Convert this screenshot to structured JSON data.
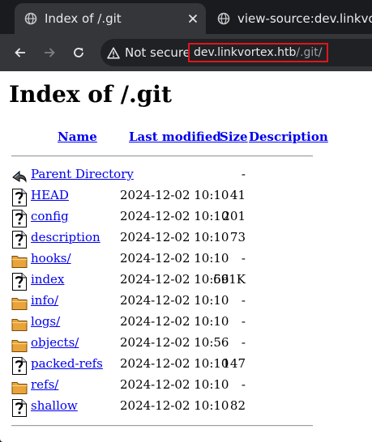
{
  "browser": {
    "tabs": [
      {
        "title": "Index of /.git",
        "active": true
      },
      {
        "title": "view-source:dev.linkvortex.htb/.git/",
        "active": false
      }
    ],
    "security_label": "Not secure",
    "url_host": "dev.linkvortex.htb",
    "url_path": "/.git/",
    "url_highlight_color": "#e0161c"
  },
  "page": {
    "heading": "Index of /.git",
    "columns": {
      "name": "Name",
      "modified": "Last modified",
      "size": "Size",
      "description": "Description"
    },
    "entries": [
      {
        "icon": "back-icon",
        "name": "Parent Directory",
        "modified": "",
        "size": "-"
      },
      {
        "icon": "unknown-file-icon",
        "name": "HEAD",
        "modified": "2024-12-02 10:10",
        "size": "41"
      },
      {
        "icon": "unknown-file-icon",
        "name": "config",
        "modified": "2024-12-02 10:10",
        "size": "201"
      },
      {
        "icon": "unknown-file-icon",
        "name": "description",
        "modified": "2024-12-02 10:10",
        "size": "73"
      },
      {
        "icon": "folder-icon",
        "name": "hooks/",
        "modified": "2024-12-02 10:10",
        "size": "-"
      },
      {
        "icon": "unknown-file-icon",
        "name": "index",
        "modified": "2024-12-02 10:56",
        "size": "691K"
      },
      {
        "icon": "folder-icon",
        "name": "info/",
        "modified": "2024-12-02 10:10",
        "size": "-"
      },
      {
        "icon": "folder-icon",
        "name": "logs/",
        "modified": "2024-12-02 10:10",
        "size": "-"
      },
      {
        "icon": "folder-icon",
        "name": "objects/",
        "modified": "2024-12-02 10:56",
        "size": "-"
      },
      {
        "icon": "unknown-file-icon",
        "name": "packed-refs",
        "modified": "2024-12-02 10:10",
        "size": "147"
      },
      {
        "icon": "folder-icon",
        "name": "refs/",
        "modified": "2024-12-02 10:10",
        "size": "-"
      },
      {
        "icon": "unknown-file-icon",
        "name": "shallow",
        "modified": "2024-12-02 10:10",
        "size": "82"
      }
    ]
  }
}
